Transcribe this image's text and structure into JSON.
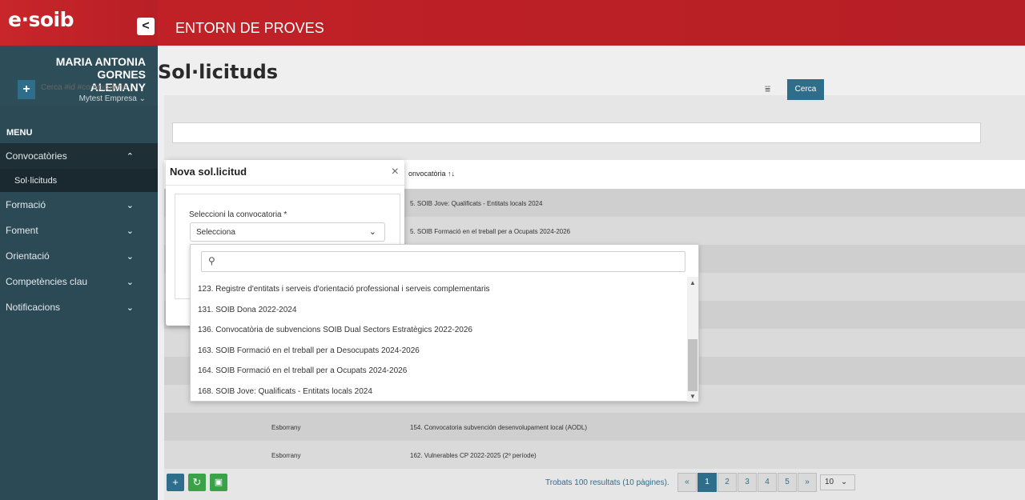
{
  "brand": {
    "logo": "e·soib",
    "collapse": "<"
  },
  "header": {
    "environment": "ENTORN DE PROVES"
  },
  "user": {
    "name_line1": "MARIA ANTONIA GORNES",
    "name_line2": "ALEMANY",
    "company": "Mytest Empresa"
  },
  "sidebar": {
    "menu_label": "MENU",
    "items": [
      {
        "label": "Convocatòries",
        "chevron": "⌃"
      },
      {
        "label": "Sol·licituds"
      },
      {
        "label": "Formació",
        "chevron": "⌄"
      },
      {
        "label": "Foment",
        "chevron": "⌄"
      },
      {
        "label": "Orientació",
        "chevron": "⌄"
      },
      {
        "label": "Competències clau",
        "chevron": "⌄"
      },
      {
        "label": "Notificacions",
        "chevron": "⌄"
      }
    ]
  },
  "page": {
    "title": "Sol·licituds"
  },
  "search": {
    "placeholder": "Cerca #id #convocatoria",
    "button": "Cerca"
  },
  "table": {
    "column_header": "onvocatòria ↑↓",
    "rows": [
      {
        "status": "",
        "call": "5. SOIB Jove: Qualificats - Entitats locals 2024"
      },
      {
        "status": "",
        "call": "5. SOIB Formació en el treball per a Ocupats 2024-2026"
      },
      {
        "status": "",
        "call": ""
      },
      {
        "status": "",
        "call": ""
      },
      {
        "status": "",
        "call": ""
      },
      {
        "status": "",
        "call": ""
      },
      {
        "status": "",
        "call": ""
      },
      {
        "status": "",
        "call": ""
      },
      {
        "status": "Esborrany",
        "call": "154. Convocatoria subvención desenvolupament local (AODL)"
      },
      {
        "status": "Esborrany",
        "call": "162. Vulnerables CP 2022-2025 (2º període)"
      }
    ]
  },
  "footer": {
    "results": "Trobats 100 resultats (10 pàgines).",
    "pages": [
      "«",
      "1",
      "2",
      "3",
      "4",
      "5",
      "»"
    ],
    "per_page": "10"
  },
  "modal": {
    "title": "Nova sol.licitud",
    "close": "×",
    "field_label": "Seleccioni la convocatoria *",
    "select_value": "Selecciona"
  },
  "dropdown": {
    "options": [
      "123. Registre d'entitats i serveis d'orientació professional i serveis complementaris",
      "131. SOIB Dona 2022-2024",
      "136. Convocatòria de subvencions SOIB Dual Sectors Estratègics 2022-2026",
      "163. SOIB Formació en el treball per a Desocupats 2024-2026",
      "164. SOIB Formació en el treball per a Ocupats 2024-2026",
      "168. SOIB Jove: Qualificats - Entitats locals 2024"
    ]
  }
}
